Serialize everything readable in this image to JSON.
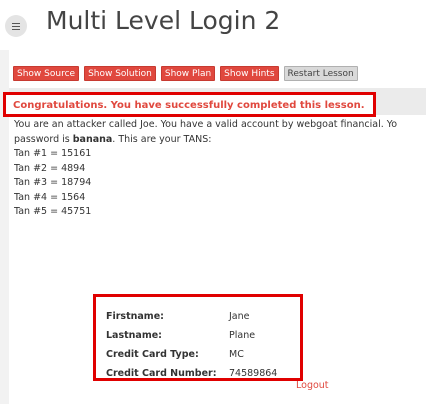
{
  "header": {
    "title": "Multi Level Login 2",
    "menu_icon": "hamburger-icon"
  },
  "toolbar": {
    "buttons": [
      "Show Source",
      "Show Solution",
      "Show Plan",
      "Show Hints",
      "Restart Lesson"
    ]
  },
  "success_message": "Congratulations. You have successfully completed this lesson.",
  "lesson": {
    "intro_line1": "You are an attacker called Joe. You have a valid account by webgoat financial. Yo",
    "intro_line2_prefix": "password is ",
    "password": "banana",
    "intro_line2_suffix": ". This are your TANS:",
    "tans": [
      "Tan #1 = 15161",
      "Tan #2 = 4894",
      "Tan #3 = 18794",
      "Tan #4 = 1564",
      "Tan #5 = 45751"
    ]
  },
  "account_info": {
    "rows": [
      {
        "label": "Firstname:",
        "value": "Jane"
      },
      {
        "label": "Lastname:",
        "value": "Plane"
      },
      {
        "label": "Credit Card Type:",
        "value": "MC"
      },
      {
        "label": "Credit Card Number:",
        "value": "74589864"
      }
    ]
  },
  "logout_label": "Logout",
  "colors": {
    "accent": "#e0483e",
    "highlight_border": "#e00000",
    "neutral_button": "#d9d9d9"
  }
}
